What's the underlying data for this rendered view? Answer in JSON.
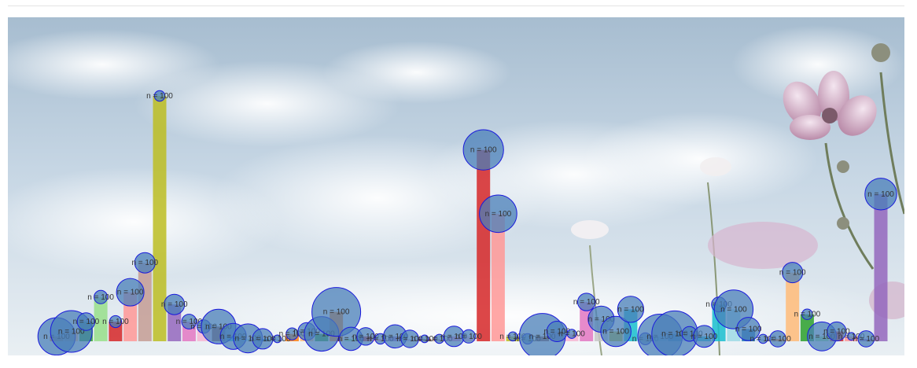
{
  "chart_data": {
    "type": "bar",
    "ylim": [
      0,
      100
    ],
    "grid": false,
    "background": "sky-with-flowers photo",
    "bubble_label": "n = 100",
    "bubble_color": "#4a7fb8",
    "bubble_stroke": "#1a1adc",
    "values": [
      2,
      4,
      8,
      18,
      8,
      20,
      32,
      100,
      15,
      8,
      6,
      6,
      2,
      1,
      1,
      1,
      3,
      4,
      3,
      12,
      1,
      2,
      1,
      2,
      1,
      1,
      1,
      2,
      2,
      78,
      52,
      2,
      1,
      2,
      4,
      3,
      16,
      9,
      4,
      13,
      1,
      2,
      3,
      3,
      2,
      15,
      13,
      5,
      1,
      1,
      28,
      11,
      2,
      4,
      2,
      1,
      60
    ],
    "colors": [
      "#ff7f0e",
      "#ffbb78",
      "#2ca02c",
      "#98df8a",
      "#d62728",
      "#ff9896",
      "#c49c94",
      "#bcbd22",
      "#9467bd",
      "#e377c2",
      "#f7b6d2",
      "#8c564b",
      "#17becf",
      "#9edae5",
      "#1f77b4",
      "#aec7e8",
      "#ff7f0e",
      "#ffbb78",
      "#2ca02c",
      "#ff7f0e",
      "#98df8a",
      "#d62728",
      "#ff9896",
      "#9467bd",
      "#c5b0d5",
      "#8c564b",
      "#c49c94",
      "#e377c2",
      "#f7b6d2",
      "#d62728",
      "#ff9896",
      "#bcbd22",
      "#dbdb8d",
      "#8c564b",
      "#e377c2",
      "#f7b6d2",
      "#e377c2",
      "#c7c7c7",
      "#bcbd22",
      "#17becf",
      "#dbdb8d",
      "#9edae5",
      "#1f77b4",
      "#aec7e8",
      "#17becf",
      "#17becf",
      "#9edae5",
      "#1f77b4",
      "#aec7e8",
      "#ff7f0e",
      "#ffbb78",
      "#2ca02c",
      "#98df8a",
      "#d62728",
      "#ff9896",
      "#9467bd",
      "#9467bd"
    ],
    "bubble_sizes": [
      22,
      25,
      8,
      5,
      4,
      15,
      10,
      3,
      10,
      6,
      5,
      20,
      14,
      16,
      10,
      1,
      4,
      8,
      20,
      30,
      12,
      8,
      3,
      12,
      8,
      1,
      2,
      10,
      5,
      24,
      22,
      2,
      3,
      28,
      10,
      2,
      8,
      14,
      17,
      14,
      4,
      27,
      28,
      6,
      11,
      6,
      23,
      12,
      2,
      7,
      10,
      3,
      16,
      9,
      1,
      7,
      18
    ]
  }
}
